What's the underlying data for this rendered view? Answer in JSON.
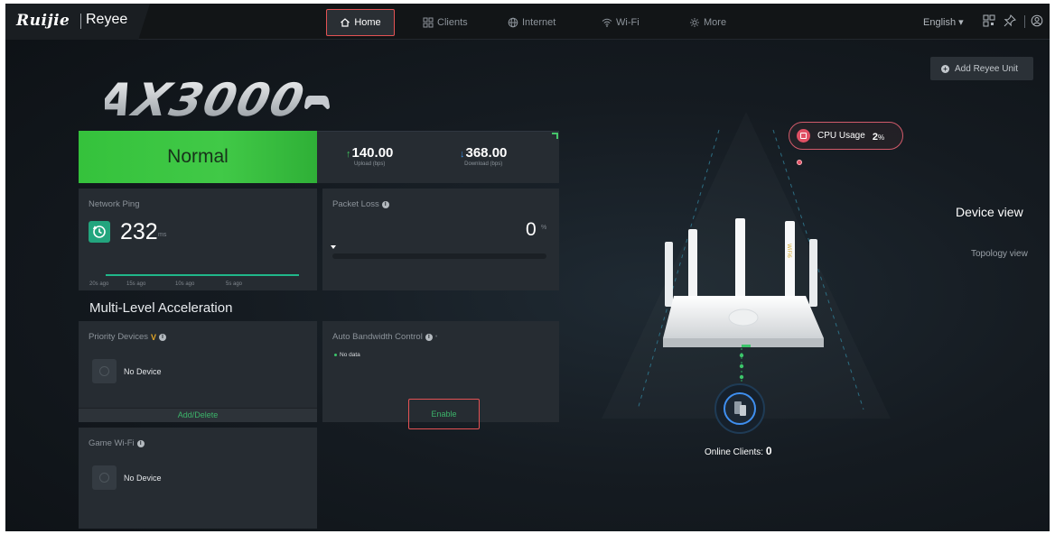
{
  "header": {
    "logo_brand": "Ruijie",
    "logo_product": "Reyee",
    "nav": [
      {
        "label": "Home",
        "icon": "home-icon",
        "active": true
      },
      {
        "label": "Clients",
        "icon": "grid-icon"
      },
      {
        "label": "Internet",
        "icon": "globe-icon"
      },
      {
        "label": "Wi-Fi",
        "icon": "wifi-icon"
      },
      {
        "label": "More",
        "icon": "gear-icon"
      }
    ],
    "language": "English",
    "icons": [
      "qr-code-icon",
      "pin-icon",
      "account-icon"
    ]
  },
  "hero": {
    "model_logo": "AX3000",
    "add_unit_label": "Add Reyee Unit"
  },
  "status": {
    "label": "Normal",
    "upload_value": "140.00",
    "upload_caption": "Upload (bps)",
    "download_value": "368.00",
    "download_caption": "Download (bps)"
  },
  "ping": {
    "title": "Network Ping",
    "value": "232",
    "unit": "ms",
    "ticks": [
      "20s ago",
      "15s ago",
      "10s ago",
      "5s ago"
    ]
  },
  "packet_loss": {
    "title": "Packet Loss",
    "value": "0",
    "unit": "%",
    "level_fraction": 0
  },
  "acceleration": {
    "title": "Multi-Level Acceleration",
    "priority": {
      "title": "Priority Devices",
      "empty_label": "No Device",
      "action": "Add/Delete"
    },
    "bandwidth": {
      "title": "Auto Bandwidth Control",
      "status": "No data",
      "action": "Enable"
    },
    "game_wifi": {
      "title": "Game Wi-Fi",
      "empty_label": "No Device"
    }
  },
  "device": {
    "cpu_label": "CPU Usage",
    "cpu_value": "2",
    "cpu_unit": "%",
    "view_tabs": [
      "Device view",
      "Topology view"
    ],
    "online_clients_label": "Online Clients:",
    "online_clients_count": "0"
  },
  "colors": {
    "accent_green": "#41c947",
    "highlight_red": "#e45254",
    "cpu_pink": "#e05064",
    "teal": "#23a57e"
  }
}
